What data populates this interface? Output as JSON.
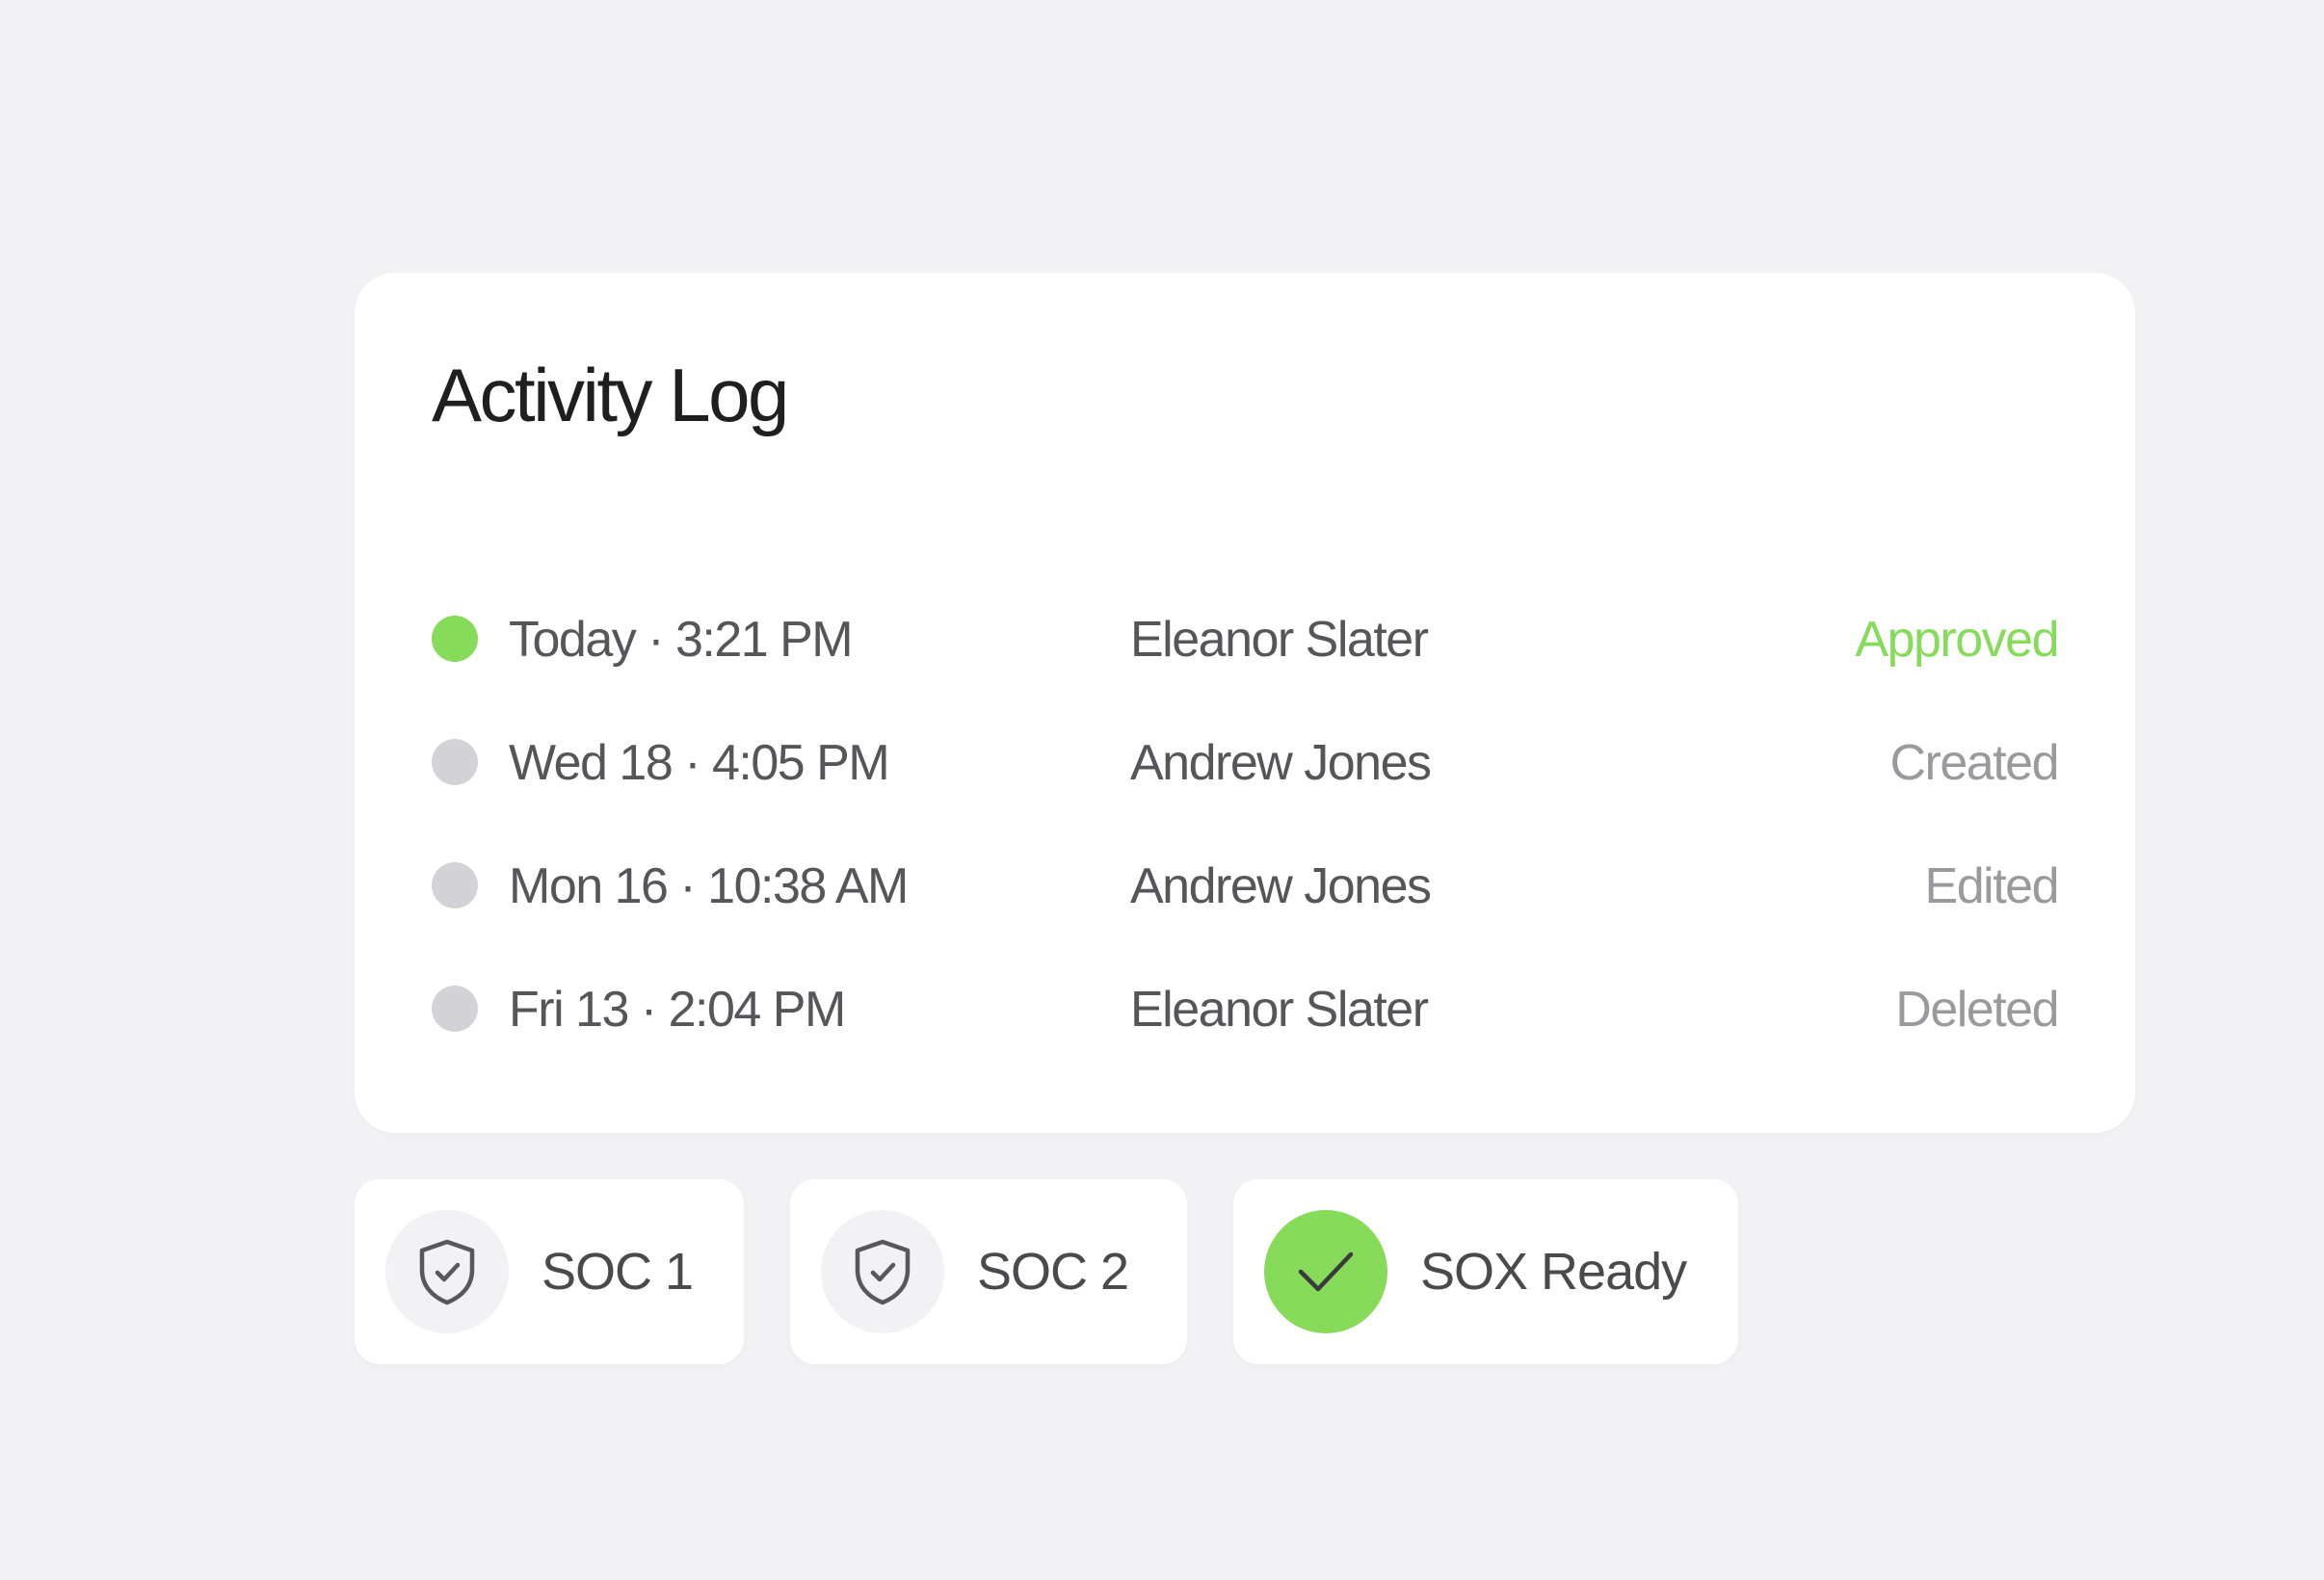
{
  "activity_log": {
    "title": "Activity Log",
    "rows": [
      {
        "time": "Today · 3:21 PM",
        "user": "Eleanor Slater",
        "action": "Approved",
        "dot_color": "#86db5a",
        "action_color": "#86db5a"
      },
      {
        "time": "Wed 18 · 4:05 PM",
        "user": "Andrew Jones",
        "action": "Created",
        "dot_color": "#d3d2d6",
        "action_color": "#9a9a9e"
      },
      {
        "time": "Mon 16 · 10:38 AM",
        "user": "Andrew Jones",
        "action": "Edited",
        "dot_color": "#d3d2d6",
        "action_color": "#9a9a9e"
      },
      {
        "time": "Fri 13 · 2:04 PM",
        "user": "Eleanor Slater",
        "action": "Deleted",
        "dot_color": "#d3d2d6",
        "action_color": "#9a9a9e"
      }
    ]
  },
  "badges": [
    {
      "label": "SOC 1",
      "icon": "shield-check-icon",
      "icon_bg": "#f2f1f3"
    },
    {
      "label": "SOC 2",
      "icon": "shield-check-icon",
      "icon_bg": "#f2f1f3"
    },
    {
      "label": "SOX Ready",
      "icon": "checkmark-icon",
      "icon_bg": "#86db5a"
    }
  ],
  "colors": {
    "background": "#f2f1f3",
    "card": "#ffffff",
    "accent_green": "#86db5a",
    "muted_text": "#9a9a9e",
    "body_text": "#55555a",
    "title_text": "#1f1f21"
  }
}
